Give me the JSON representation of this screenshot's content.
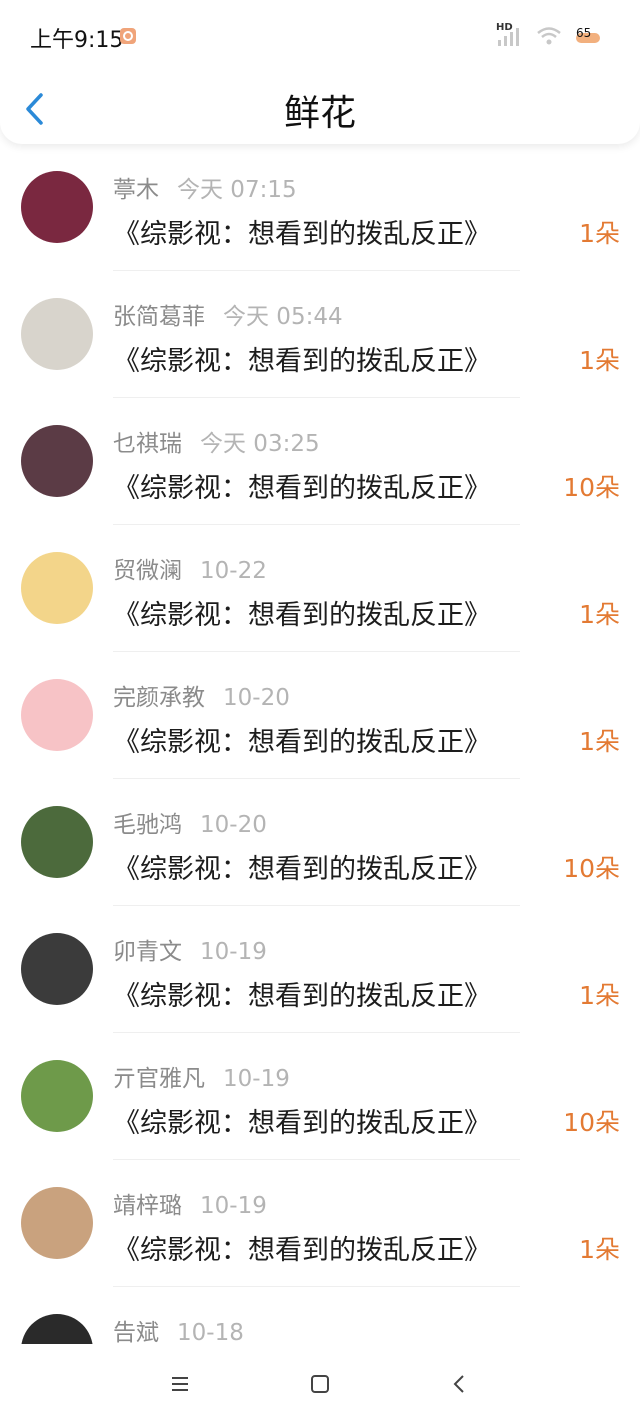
{
  "status": {
    "time": "上午9:15",
    "network": "HD",
    "battery": "65"
  },
  "header": {
    "title": "鲜花"
  },
  "list": [
    {
      "name": "葶木",
      "time": "今天 07:15",
      "book": "《综影视：想看到的拨乱反正》",
      "count": "1朵"
    },
    {
      "name": "张简葛菲",
      "time": "今天 05:44",
      "book": "《综影视：想看到的拨乱反正》",
      "count": "1朵"
    },
    {
      "name": "乜祺瑞",
      "time": "今天 03:25",
      "book": "《综影视：想看到的拨乱反正》",
      "count": "10朵"
    },
    {
      "name": "贸微澜",
      "time": "10-22",
      "book": "《综影视：想看到的拨乱反正》",
      "count": "1朵"
    },
    {
      "name": "完颜承教",
      "time": "10-20",
      "book": "《综影视：想看到的拨乱反正》",
      "count": "1朵"
    },
    {
      "name": "毛驰鸿",
      "time": "10-20",
      "book": "《综影视：想看到的拨乱反正》",
      "count": "10朵"
    },
    {
      "name": "卯青文",
      "time": "10-19",
      "book": "《综影视：想看到的拨乱反正》",
      "count": "1朵"
    },
    {
      "name": "亓官雅凡",
      "time": "10-19",
      "book": "《综影视：想看到的拨乱反正》",
      "count": "10朵"
    },
    {
      "name": "靖梓璐",
      "time": "10-19",
      "book": "《综影视：想看到的拨乱反正》",
      "count": "1朵"
    },
    {
      "name": "告斌",
      "time": "10-18",
      "book": "",
      "count": ""
    }
  ],
  "avatar_colors": [
    "#7a2840",
    "#d8d4cc",
    "#5b3b45",
    "#f3d58a",
    "#f7c3c6",
    "#4c6a3c",
    "#3b3b3b",
    "#6e9a4a",
    "#c9a27e",
    "#2a2a2a"
  ],
  "colors": {
    "accent": "#e37a33",
    "back": "#2b8ad8"
  },
  "icons": {
    "back": "chevron-left-icon",
    "menu": "menu-icon",
    "home": "home-square-icon",
    "nav_back": "back-triangle-icon"
  }
}
